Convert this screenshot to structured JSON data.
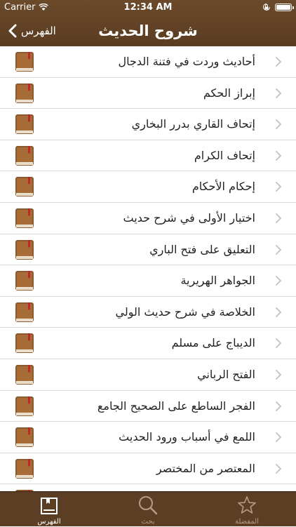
{
  "status": {
    "carrier": "Carrier",
    "time": "12:34 AM"
  },
  "nav": {
    "title": "شروح الحديث",
    "back_label": "الفهرس"
  },
  "items": [
    {
      "label": "أحاديث وردت في فتنة الدجال"
    },
    {
      "label": "إبراز الحكم"
    },
    {
      "label": "إتحاف القاري بدرر البخاري"
    },
    {
      "label": "إتحاف الكرام"
    },
    {
      "label": "إحكام الأحكام"
    },
    {
      "label": "اختيار الأولى في شرح حديث"
    },
    {
      "label": "التعليق على فتح الباري"
    },
    {
      "label": "الجواهر الهريرية"
    },
    {
      "label": "الخلاصة في شرح حديث الولي"
    },
    {
      "label": "الديباج على مسلم"
    },
    {
      "label": "الفتح الرباني"
    },
    {
      "label": "الفجر الساطع على الصحيح الجامع"
    },
    {
      "label": "اللمع في أسباب ورود الحديث"
    },
    {
      "label": "المعتصر من المختصر"
    }
  ],
  "tabs": [
    {
      "label": "الفهرس",
      "icon": "book-icon"
    },
    {
      "label": "بحث",
      "icon": "search-icon"
    },
    {
      "label": "المفضلة",
      "icon": "star-icon"
    }
  ],
  "colors": {
    "header": "#5a3c22",
    "tab_active": "#ffffff",
    "tab_inactive": "#b59c86"
  }
}
